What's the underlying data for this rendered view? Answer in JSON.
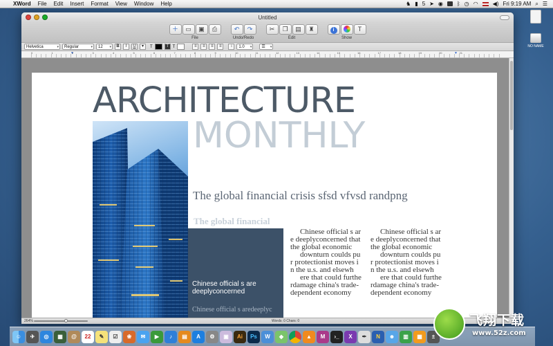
{
  "menubar": {
    "items": [
      "XWord",
      "File",
      "Edit",
      "Insert",
      "Format",
      "View",
      "Window",
      "Help"
    ],
    "status": {
      "volume_count": "5",
      "time": "Fri 9:19 AM"
    }
  },
  "desktop": {
    "drive_label": "NO NAME"
  },
  "window": {
    "title": "Untitled",
    "toolbar": {
      "groups": [
        {
          "label": "File",
          "buttons": [
            "new-document",
            "open",
            "save",
            "print"
          ]
        },
        {
          "label": "Undo/Redo",
          "buttons": [
            "undo",
            "redo"
          ]
        },
        {
          "label": "Edit",
          "buttons": [
            "cut",
            "copy",
            "paste",
            "format-painter"
          ]
        },
        {
          "label": "Show",
          "buttons": [
            "info",
            "colors",
            "fonts"
          ]
        }
      ],
      "fonts_glyph": "T",
      "info_glyph": "i"
    },
    "format": {
      "font_family": "Helvetica",
      "font_style": "Regular",
      "font_size": "12",
      "bold": "B",
      "italic": "I",
      "underline": "U",
      "text_glyph": "T",
      "line_spacing": "1.0",
      "text_color": "#000000",
      "highlight_color": "#ffffff"
    },
    "ruler": {
      "numbers": [
        "0",
        "1",
        "2",
        "3",
        "4",
        "5",
        "6",
        "7",
        "8",
        "9",
        "10",
        "11",
        "12",
        "13",
        "14",
        "15",
        "16",
        "17",
        "18",
        "19",
        "20",
        "21"
      ]
    },
    "status": {
      "zoom": "264%",
      "counts": "Words: 0   Chars: 0"
    }
  },
  "document": {
    "title_line1": "ARCHITECTURE",
    "title_line2": "MONTHLY",
    "headline": "The global financial crisis sfsd vfvsd randpng",
    "subheadline": "The global financial",
    "box_text_1": "Chinese official s are deeplyconcerned",
    "box_text_2": "Chinese official s aredeeplyc",
    "column_1": [
      "Chinese official s are deeplyconcerned that the global economic",
      "downturn coulds pur protectionist moves in the u.s. and elsewh",
      "ere that could furtherdamage china's trade-dependent economy"
    ],
    "column_2": [
      "Chinese official s are deeplyconcerned that the global economic",
      "downturn coulds pur protectionist moves in the u.s. and elsewh",
      "ere that could furtherdamage china's trade-dependent economy"
    ]
  },
  "dock": {
    "apps": [
      "finder",
      "launchpad",
      "safari",
      "mission-control",
      "contacts",
      "calendar",
      "notes",
      "reminders",
      "photo",
      "messages",
      "facetime",
      "itunes",
      "ibooks",
      "app-store",
      "system-preferences",
      "preview",
      "illustrator",
      "photoshop",
      "xword",
      "maps",
      "chrome",
      "vlc",
      "motion",
      "terminal",
      "xtranslate",
      "quill",
      "maven",
      "finder-2",
      "numbers",
      "pages",
      "calculator"
    ]
  },
  "watermark": {
    "title": "飞翔下载",
    "url": "www.52z.com"
  },
  "colors": {
    "title_dark": "#4d5a67",
    "title_light": "#c3cdd6",
    "box_bg": "#3c5168",
    "accent": "#3b73d8"
  }
}
